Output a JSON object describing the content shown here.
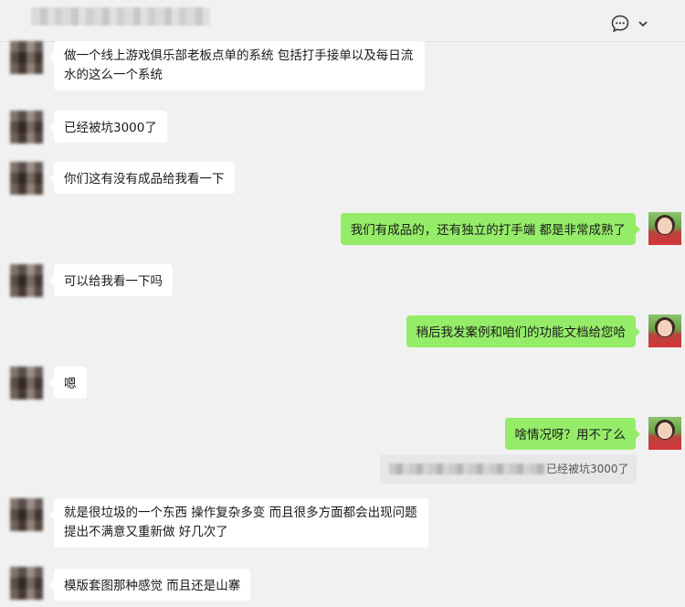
{
  "header": {
    "chat_title": "群聊",
    "more_icon": "chat-bubble-more-icon",
    "chevron_icon": "chevron-down-icon"
  },
  "messages": [
    {
      "side": "in",
      "text": "做一个线上游戏俱乐部老板点单的系统 包括打手接单以及每日流水的这么一个系统"
    },
    {
      "side": "in",
      "text": "已经被坑3000了"
    },
    {
      "side": "in",
      "text": "你们这有没有成品给我看一下"
    },
    {
      "side": "out",
      "text": "我们有成品的，还有独立的打手端 都是非常成熟了"
    },
    {
      "side": "in",
      "text": "可以给我看一下吗"
    },
    {
      "side": "out",
      "text": "稍后我发案例和咱们的功能文档给您哈"
    },
    {
      "side": "in",
      "text": "嗯"
    },
    {
      "side": "out",
      "text": "啥情况呀？用不了么"
    },
    {
      "side": "in",
      "text": "就是很垃圾的一个东西 操作复杂多变 而且很多方面都会出现问题 提出不满意又重新做 好几次了"
    },
    {
      "side": "in",
      "text": "模版套图那种感觉 而且还是山寨"
    }
  ],
  "quote": {
    "text": "已经被坑3000了"
  },
  "colors": {
    "background": "#f1f1f1",
    "incoming_bubble": "#ffffff",
    "outgoing_bubble": "#95ec69"
  }
}
